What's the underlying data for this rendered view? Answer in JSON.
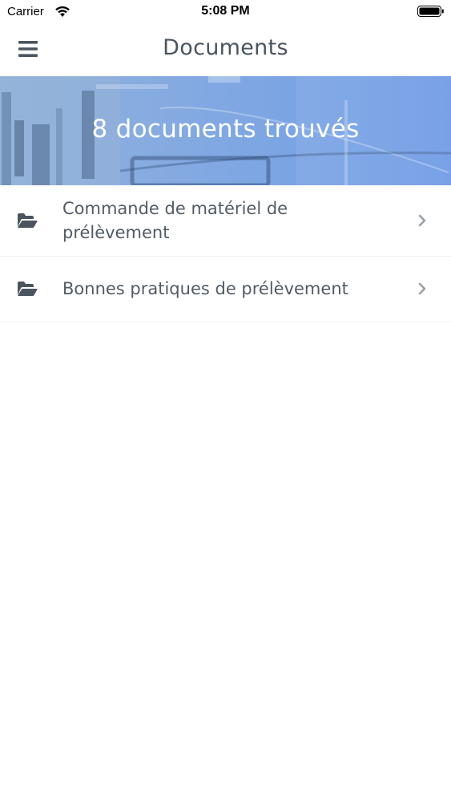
{
  "status_bar": {
    "carrier": "Carrier",
    "time": "5:08 PM"
  },
  "nav": {
    "title": "Documents",
    "menu_icon": "hamburger-menu-icon"
  },
  "banner": {
    "headline": "8 documents trouvés"
  },
  "documents": [
    {
      "label": "Commande de matériel de prélèvement",
      "icon": "folder-open-icon"
    },
    {
      "label": "Bonnes pratiques de prélèvement",
      "icon": "folder-open-icon"
    }
  ],
  "colors": {
    "text": "#4a5560",
    "banner": "#7ba4e4",
    "icon": "#4a5560",
    "chevron": "#9aa0a6"
  }
}
